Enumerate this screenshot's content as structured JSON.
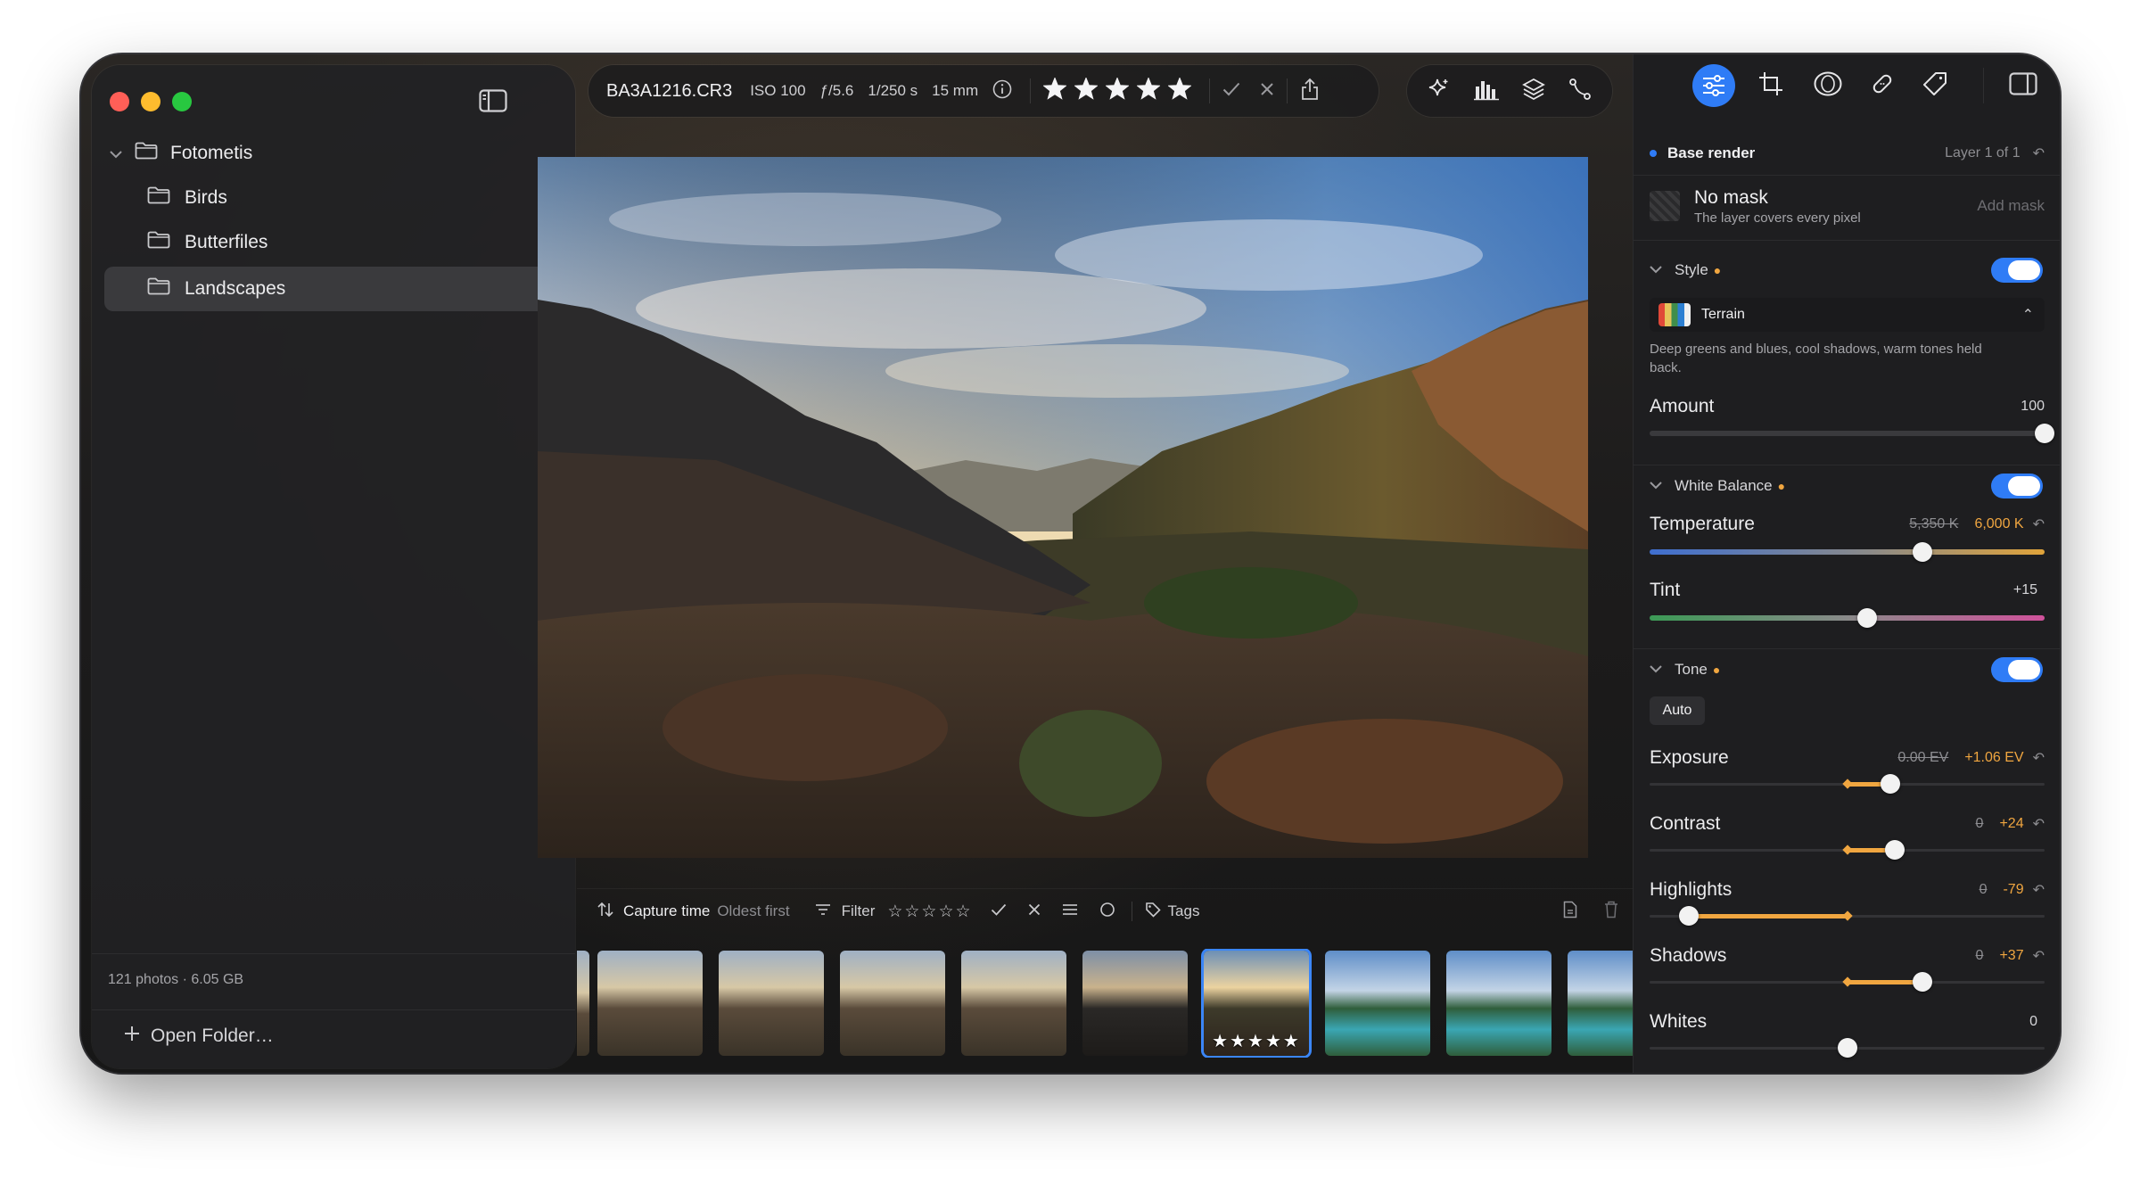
{
  "sidebar": {
    "root": "Fotometis",
    "folders": [
      "Birds",
      "Butterfiles",
      "Landscapes"
    ],
    "footer_stats": "121 photos · 6.05 GB",
    "open_folder": "Open Folder…"
  },
  "toolbar": {
    "filename": "BA3A1216.CR3",
    "iso": "ISO 100",
    "aperture": "ƒ/5.6",
    "shutter": "1/250 s",
    "focal": "15 mm",
    "rating": 5
  },
  "filterbar": {
    "sort_label": "Capture time",
    "sort_order": "Oldest first",
    "filter_label": "Filter",
    "tags_label": "Tags"
  },
  "filmstrip": {
    "thumbs": [
      {
        "kind": "desert"
      },
      {
        "kind": "desert"
      },
      {
        "kind": "desert"
      },
      {
        "kind": "desert"
      },
      {
        "kind": "dark"
      },
      {
        "kind": "selected",
        "stars": "★★★★★"
      },
      {
        "kind": "lake"
      },
      {
        "kind": "lake"
      },
      {
        "kind": "lake"
      },
      {
        "kind": "lake"
      }
    ]
  },
  "inspector": {
    "layer_name": "Base render",
    "layer_count": "Layer 1 of 1",
    "mask_title": "No mask",
    "mask_desc": "The layer covers every pixel",
    "add_mask": "Add mask",
    "style": {
      "label": "Style",
      "preset": "Terrain",
      "description": "Deep greens and blues, cool shadows, warm tones held back.",
      "amount_label": "Amount",
      "amount_value": "100",
      "amount": 1.0
    },
    "white_balance": {
      "label": "White Balance",
      "temp_label": "Temperature",
      "temp_old": "5,350 K",
      "temp_new": "6,000 K",
      "temp_pos": 0.69,
      "tint_label": "Tint",
      "tint_value": "+15",
      "tint_pos": 0.55
    },
    "tone": {
      "label": "Tone",
      "auto": "Auto",
      "sliders": [
        {
          "label": "Exposure",
          "old": "0.00 EV",
          "new": "+1.06 EV",
          "from": 0.5,
          "to": 0.61
        },
        {
          "label": "Contrast",
          "old": "0",
          "new": "+24",
          "from": 0.5,
          "to": 0.62
        },
        {
          "label": "Highlights",
          "old": "0",
          "new": "-79",
          "from": 0.5,
          "to": 0.1
        },
        {
          "label": "Shadows",
          "old": "0",
          "new": "+37",
          "from": 0.5,
          "to": 0.69
        },
        {
          "label": "Whites",
          "old": "",
          "new": "0",
          "from": 0.5,
          "to": 0.5
        }
      ]
    }
  },
  "colors": {
    "accent": "#2f7cf6",
    "changed": "#f0a640",
    "close": "#ff5f57",
    "minimize": "#febc2e",
    "zoom": "#28c840"
  }
}
